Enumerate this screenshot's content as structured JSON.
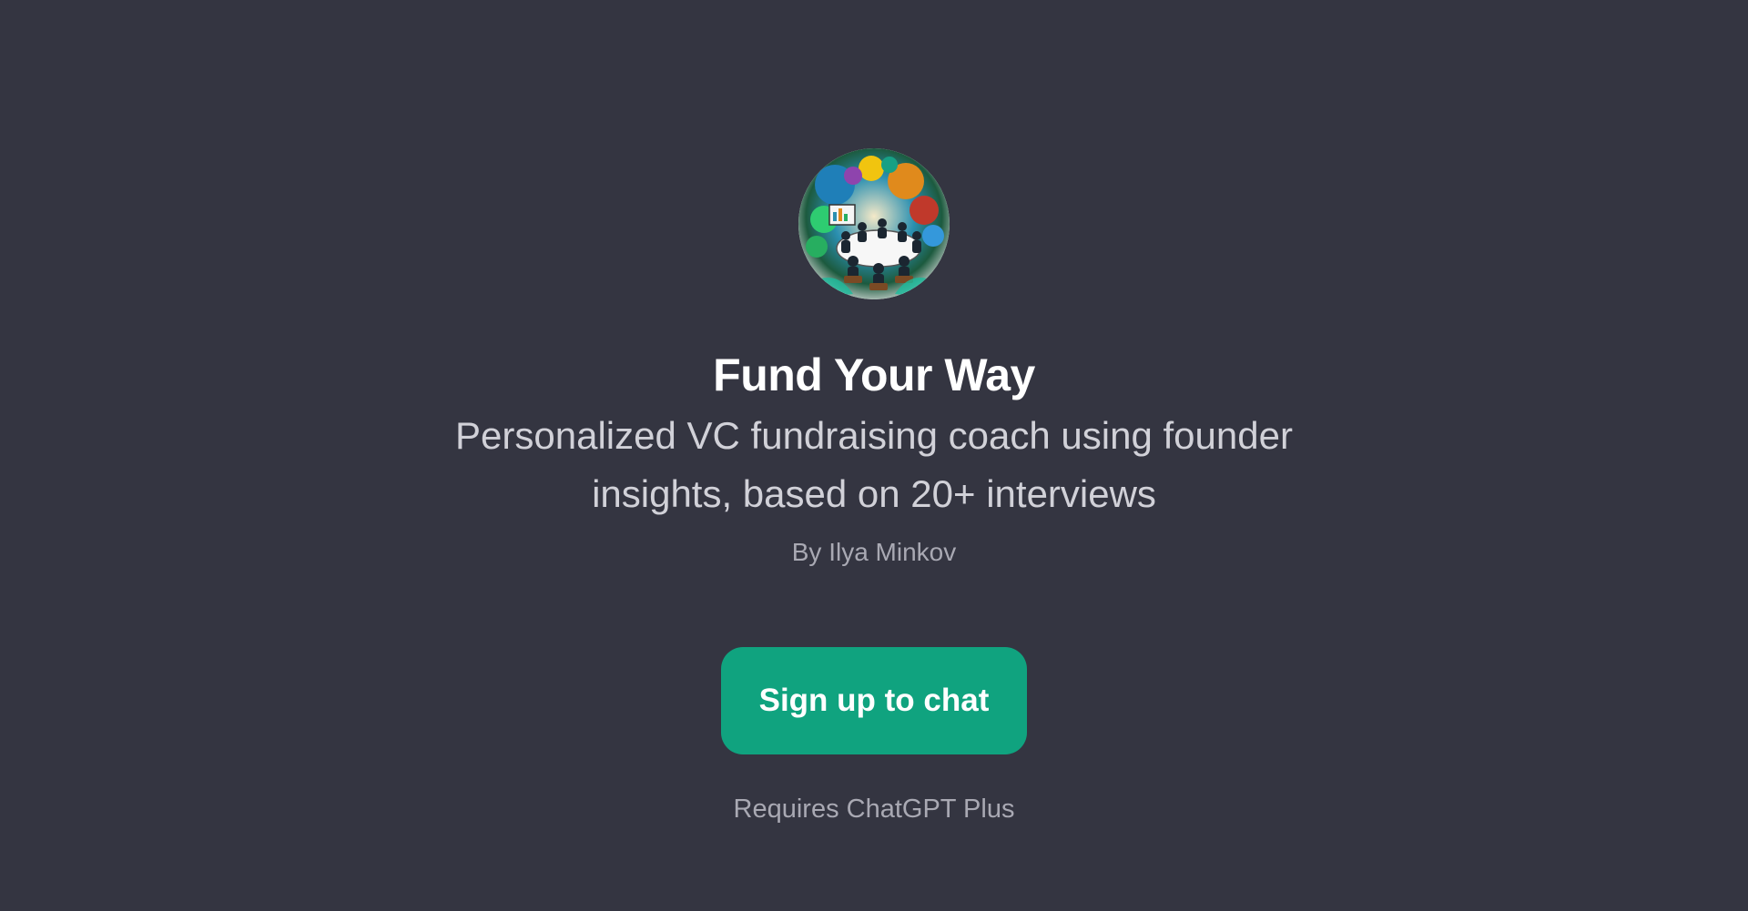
{
  "gpt": {
    "avatar_icon": "colorful-round-table-meeting-illustration",
    "title": "Fund Your Way",
    "description": "Personalized VC fundraising coach using founder insights, based on 20+ interviews",
    "author": "By Ilya Minkov"
  },
  "actions": {
    "signup_label": "Sign up to chat"
  },
  "footer": {
    "requirement": "Requires ChatGPT Plus"
  },
  "colors": {
    "background": "#343541",
    "accent": "#10a37f",
    "title": "#ffffff",
    "muted": "#a9a9b3"
  }
}
